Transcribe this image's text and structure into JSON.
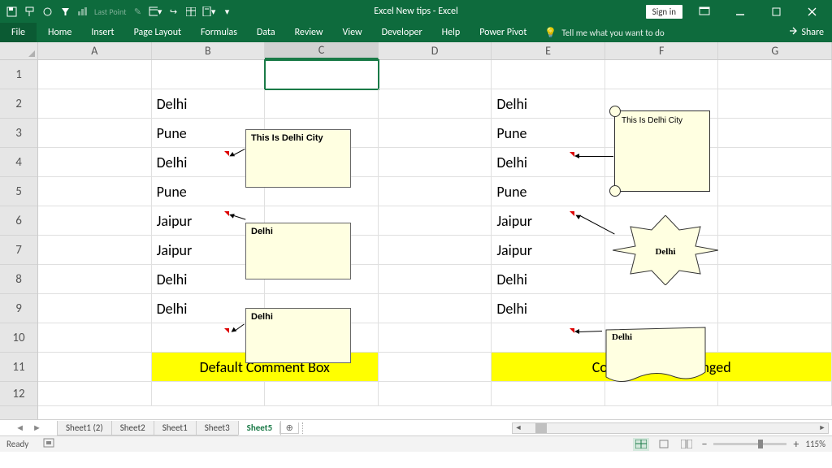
{
  "app": {
    "title": "Excel New tips - Excel",
    "signin": "Sign in"
  },
  "qat": {
    "last_point": "Last Point"
  },
  "ribbon": {
    "file": "File",
    "tabs": [
      "Home",
      "Insert",
      "Page Layout",
      "Formulas",
      "Data",
      "Review",
      "View",
      "Developer",
      "Help",
      "Power Pivot"
    ],
    "tell_me": "Tell me what you want to do",
    "share": "Share"
  },
  "columns": [
    "A",
    "B",
    "C",
    "D",
    "E",
    "F",
    "G"
  ],
  "rows": [
    "1",
    "2",
    "3",
    "4",
    "5",
    "6",
    "7",
    "8",
    "9",
    "10",
    "11",
    "12"
  ],
  "cells": {
    "b": [
      "Delhi",
      "Pune",
      "Delhi",
      "Pune",
      "Jaipur",
      "Jaipur",
      "Delhi",
      "Delhi"
    ],
    "e": [
      "Delhi",
      "Pune",
      "Delhi",
      "Pune",
      "Jaipur",
      "Jaipur",
      "Delhi",
      "Delhi"
    ],
    "label_left": "Default Comment Box",
    "label_right": "Comment Box Changed"
  },
  "comments": {
    "c1": "This Is Delhi City",
    "c2": "Delhi",
    "c3": "Delhi",
    "scroll": "This Is Delhi City",
    "star": "Delhi",
    "wave": "Delhi"
  },
  "sheets": {
    "tabs": [
      "Sheet1 (2)",
      "Sheet2",
      "Sheet1",
      "Sheet3",
      "Sheet5"
    ],
    "active": 4
  },
  "status": {
    "ready": "Ready",
    "zoom": "115%"
  }
}
